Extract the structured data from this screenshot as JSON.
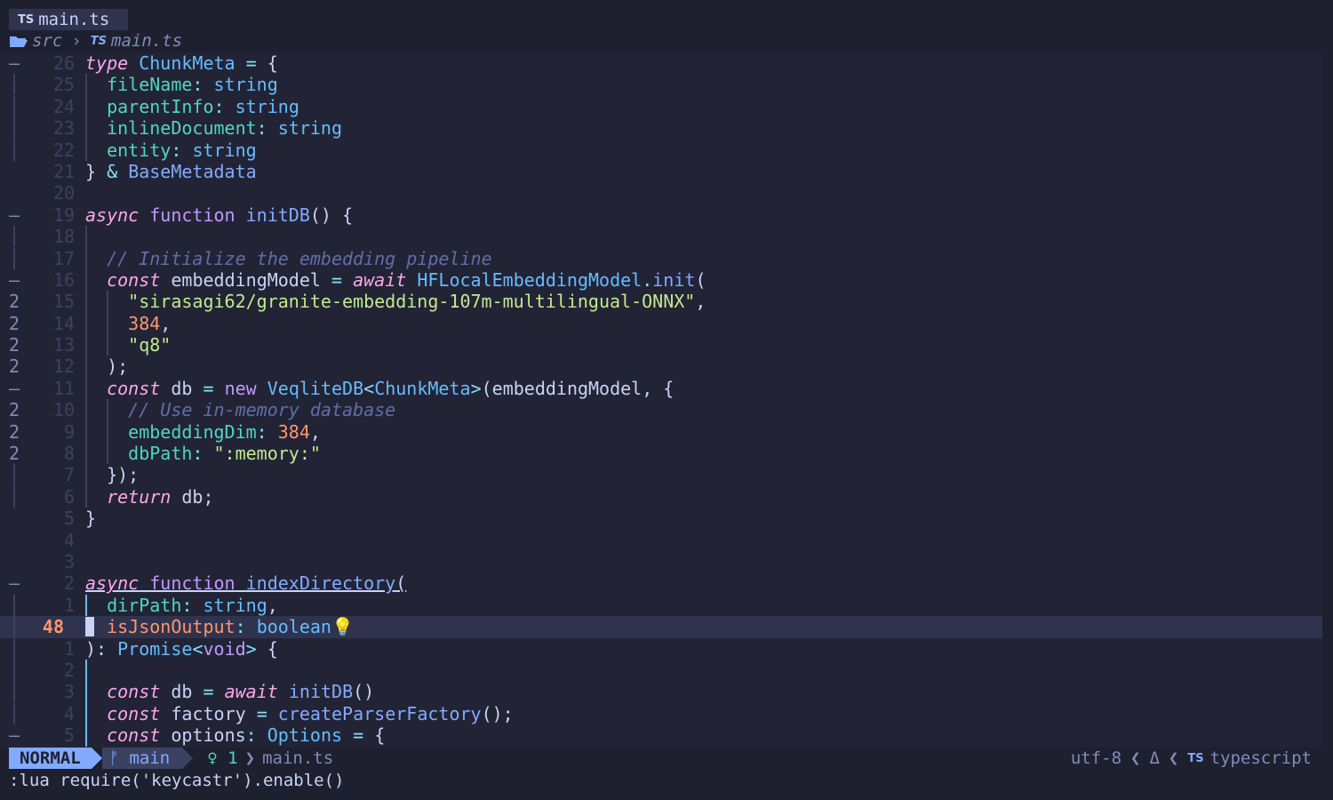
{
  "tab": {
    "icon": "TS",
    "label": "main.ts"
  },
  "breadcrumb": {
    "folder": "src",
    "sep": "›",
    "file_icon": "TS",
    "file": "main.ts"
  },
  "lines": [
    {
      "fold": "–",
      "num": "26",
      "html": "<span class='kwi'>type</span> <span class='ty'>ChunkMeta</span> <span class='pn'>=</span> <span class='tx'>{</span>"
    },
    {
      "fold": "|",
      "num": "25",
      "html": "  <span class='prop'>fileName</span><span class='pn'>:</span> <span class='ty'>string</span>",
      "bar": 1
    },
    {
      "fold": "|",
      "num": "24",
      "html": "  <span class='prop'>parentInfo</span><span class='pn'>:</span> <span class='ty'>string</span>",
      "bar": 1
    },
    {
      "fold": "|",
      "num": "23",
      "html": "  <span class='prop'>inlineDocument</span><span class='pn'>:</span> <span class='ty'>string</span>",
      "bar": 1
    },
    {
      "fold": "|",
      "num": "22",
      "html": "  <span class='prop'>entity</span><span class='pn'>:</span> <span class='ty'>string</span>",
      "bar": 1
    },
    {
      "fold": "",
      "num": "21",
      "html": "<span class='tx'>}</span> <span class='pn'>&amp;</span> <span class='fn'>BaseMetadata</span>"
    },
    {
      "fold": "",
      "num": "20",
      "html": ""
    },
    {
      "fold": "–",
      "num": "19",
      "html": "<span class='kwi'>async</span> <span class='kw'>function</span> <span class='fn'>initDB</span><span class='tx'>() {</span>"
    },
    {
      "fold": "|",
      "num": "18",
      "html": "",
      "bar": 1
    },
    {
      "fold": "|",
      "num": "17",
      "html": "  <span class='cm'>// Initialize the embedding pipeline</span>",
      "bar": 1
    },
    {
      "fold": "–",
      "num": "16",
      "html": "  <span class='kwi'>const</span> <span class='tx'>embeddingModel</span> <span class='pn'>=</span> <span class='kwi'>await</span> <span class='ty'>HFLocalEmbeddingModel</span><span class='pn'>.</span><span class='fn'>init</span><span class='tx'>(</span>",
      "bar": 1
    },
    {
      "fold": "2",
      "num": "15",
      "html": "    <span class='str'>\"sirasagi62/granite-embedding-107m-multilingual-ONNX\"</span><span class='tx'>,</span>",
      "bar": 2
    },
    {
      "fold": "2",
      "num": "14",
      "html": "    <span class='num'>384</span><span class='tx'>,</span>",
      "bar": 2
    },
    {
      "fold": "2",
      "num": "13",
      "html": "    <span class='str'>\"q8\"</span>",
      "bar": 2
    },
    {
      "fold": "2",
      "num": "12",
      "html": "  <span class='tx'>);</span>",
      "bar": 1
    },
    {
      "fold": "–",
      "num": "11",
      "html": "  <span class='kwi'>const</span> <span class='tx'>db</span> <span class='pn'>=</span> <span class='kw'>new</span> <span class='ty'>VeqliteDB</span><span class='pn'>&lt;</span><span class='ty'>ChunkMeta</span><span class='pn'>&gt;</span><span class='tx'>(embeddingModel, {</span>",
      "bar": 1
    },
    {
      "fold": "2",
      "num": "10",
      "html": "    <span class='cm'>// Use in-memory database</span>",
      "bar": 2
    },
    {
      "fold": "2",
      "num": "9",
      "html": "    <span class='prop'>embeddingDim</span><span class='pn'>:</span> <span class='num'>384</span><span class='tx'>,</span>",
      "bar": 2
    },
    {
      "fold": "2",
      "num": "8",
      "html": "    <span class='prop'>dbPath</span><span class='pn'>:</span> <span class='str'>\":memory:\"</span>",
      "bar": 2
    },
    {
      "fold": "|",
      "num": "7",
      "html": "  <span class='tx'>});</span>",
      "bar": 1
    },
    {
      "fold": "|",
      "num": "6",
      "html": "  <span class='kwi'>return</span> <span class='tx'>db;</span>",
      "bar": 1
    },
    {
      "fold": "",
      "num": "5",
      "html": "<span class='tx'>}</span>"
    },
    {
      "fold": "",
      "num": "4",
      "html": ""
    },
    {
      "fold": "",
      "num": "3",
      "html": ""
    },
    {
      "fold": "–",
      "num": "2",
      "html": "<span class='ul'><span class='kwi'>async</span> <span class='kw'>function</span> <span class='fn'>indexDirectory</span><span class='tx'>(</span></span>"
    },
    {
      "fold": "|",
      "num": "1",
      "html": "  <span class='prop'>dirPath</span><span class='pn'>:</span> <span class='ty'>string</span><span class='tx'>,</span>",
      "bar": 3
    },
    {
      "fold": "|",
      "num": "48",
      "cur": true,
      "html": "  <span class='num'>isJsonOutput</span><span class='pn'>:</span> <span class='ty'>boolean</span><span class='bulb'>💡</span>",
      "bar": 4
    },
    {
      "fold": "|",
      "num": "1",
      "html": "<span class='tx'>):</span> <span class='ty'>Promise</span><span class='pn'>&lt;</span><span class='kw'>void</span><span class='pn'>&gt;</span> <span class='tx'>{</span>"
    },
    {
      "fold": "|",
      "num": "2",
      "html": "",
      "bar": 3
    },
    {
      "fold": "|",
      "num": "3",
      "html": "  <span class='kwi'>const</span> <span class='tx'>db</span> <span class='pn'>=</span> <span class='kwi'>await</span> <span class='fn'>initDB</span><span class='tx'>()</span>",
      "bar": 3
    },
    {
      "fold": "|",
      "num": "4",
      "html": "  <span class='kwi'>const</span> <span class='tx'>factory</span> <span class='pn'>=</span> <span class='fn'>createParserFactory</span><span class='tx'>();</span>",
      "bar": 3
    },
    {
      "fold": "–",
      "num": "5",
      "html": "  <span class='kwi'>const</span> <span class='tx'>options</span><span class='pn'>:</span> <span class='ty'>Options</span> <span class='pn'>=</span> <span class='tx'>{</span>",
      "bar": 3
    }
  ],
  "status": {
    "mode": "NORMAL",
    "branch_icon": "branch-icon",
    "branch": "main",
    "diag_icon": "lightbulb-icon",
    "diag_count": "1",
    "file": "main.ts",
    "encoding": "utf-8",
    "filetype_icon": "TS",
    "filetype": "typescript"
  },
  "cmdline": ":lua require('keycastr').enable()"
}
